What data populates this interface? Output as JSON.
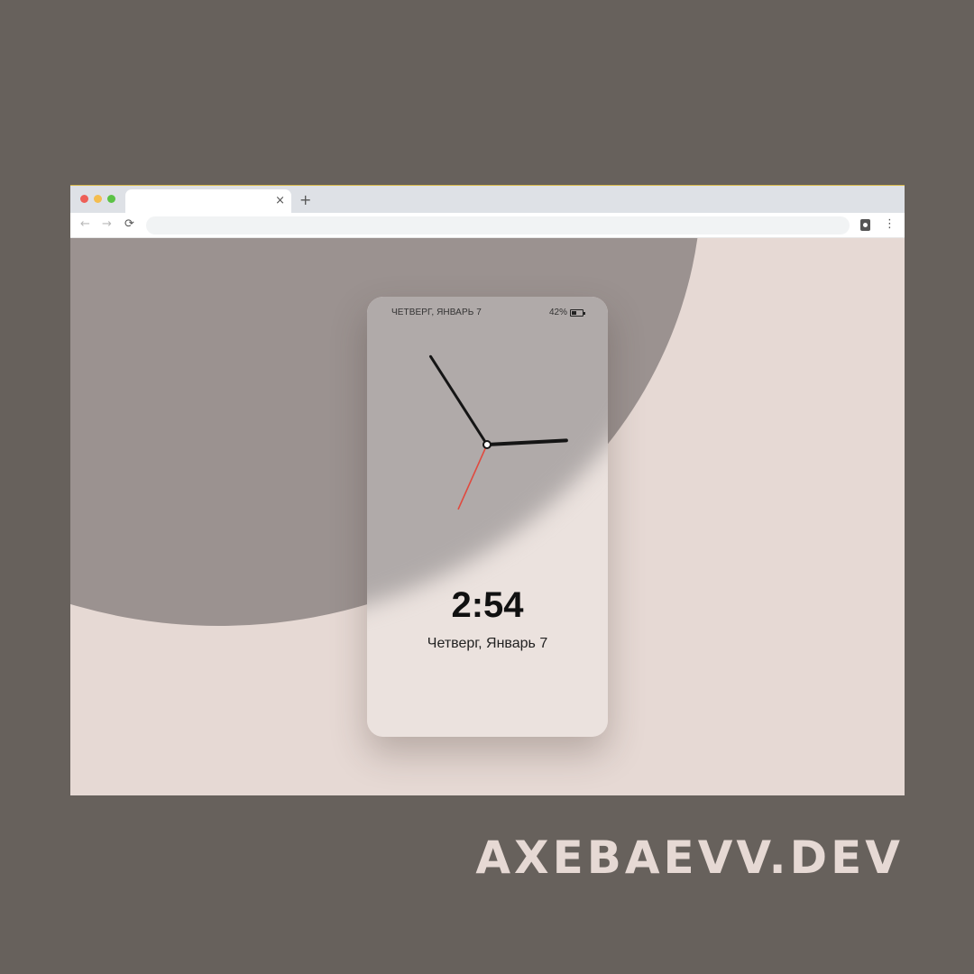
{
  "browser": {
    "tab": {
      "title": "",
      "close_label": "×"
    },
    "new_tab_label": "+",
    "toolbar": {
      "back_label": "←",
      "forward_label": "→",
      "reload_label": "⟳",
      "address_value": "",
      "menu_label": "⋮",
      "clipboard_icon": "clipboard-icon"
    },
    "window_controls": [
      "close",
      "minimize",
      "maximize"
    ]
  },
  "phone": {
    "status_date": "ЧЕТВЕРГ, ЯНВАРЬ 7",
    "battery_percent": "42%",
    "battery_level": 0.42,
    "clock": {
      "hour": 2,
      "minute": 54,
      "second": 34
    },
    "time": "2:54",
    "date": "Четверг, Январь 7"
  },
  "brand": "AXEBAEVV.DEV",
  "colors": {
    "outer_background": "#67615c",
    "page_background": "#e6d9d4",
    "blob": "#9b9290",
    "second_hand": "#e04a3f"
  }
}
